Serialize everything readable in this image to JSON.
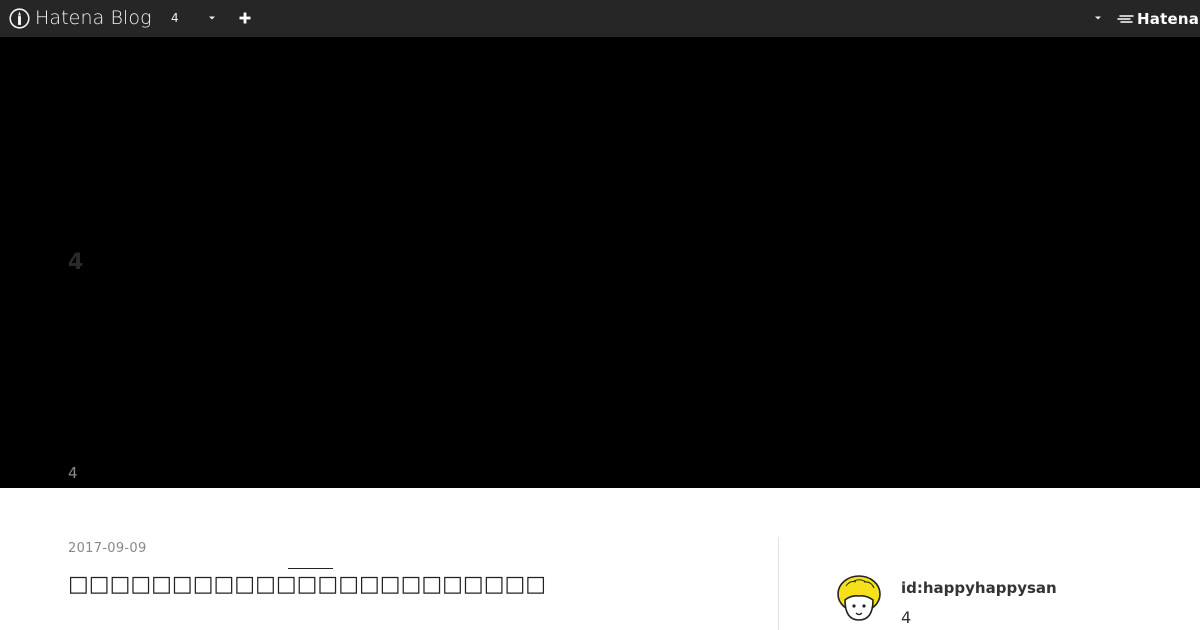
{
  "global_header": {
    "brand": "Hatena Blog",
    "blog_selector": "4",
    "hatena_brand": "Hatena"
  },
  "hero": {
    "blog_title": "4",
    "blog_description": "4"
  },
  "entry": {
    "date": "2017-09-09",
    "title": "□□□□□□□□□□□□□□□□□□□□□□□"
  },
  "profile": {
    "id": "id:happyhappysan",
    "count": "4"
  },
  "colors": {
    "header_bg": "#262626",
    "hero_bg": "#000000",
    "avatar_hair": "#f5e11a"
  }
}
